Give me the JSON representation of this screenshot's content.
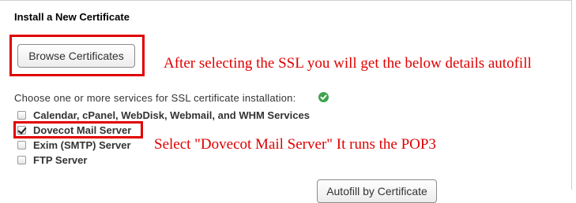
{
  "section": {
    "title": "Install a New Certificate"
  },
  "browse": {
    "label": "Browse Certificates"
  },
  "annotations": {
    "browse_note": "After selecting the SSL you will get the below details autofill",
    "dovecot_note": "Select \"Dovecot Mail Server\" It runs the POP3",
    "color": "#e00000"
  },
  "services": {
    "prompt": "Choose one or more services for SSL certificate installation:",
    "status_icon": "check-circle-icon",
    "items": [
      {
        "label": "Calendar, cPanel, WebDisk, Webmail, and WHM Services",
        "checked": false
      },
      {
        "label": "Dovecot Mail Server",
        "checked": true
      },
      {
        "label": "Exim (SMTP) Server",
        "checked": false
      },
      {
        "label": "FTP Server",
        "checked": false
      }
    ]
  },
  "autofill": {
    "label": "Autofill by Certificate"
  }
}
